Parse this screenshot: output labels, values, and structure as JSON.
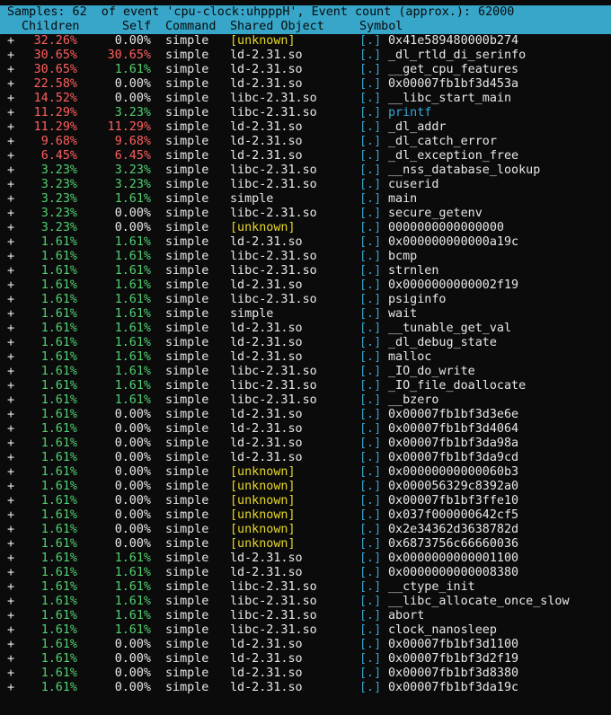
{
  "title": "Samples: 62  of event 'cpu-clock:uhpppH', Event count (approx.): 62000",
  "headers": {
    "children": "Children",
    "self": "Self",
    "command": "Command",
    "shared_object": "Shared Object",
    "symbol": "Symbol"
  },
  "colors": {
    "header_bg": "#37a6c9",
    "red": "#ff5f5f",
    "green": "#52d071",
    "yellow": "#e7d82a",
    "cyan": "#36a7d6"
  },
  "rows": [
    {
      "plus": "+",
      "children": "32.26%",
      "self": "0.00%",
      "command": "simple",
      "shared": "[unknown]",
      "mark": "[.]",
      "symbol": "0x41e589480000b274",
      "cc": "red",
      "sc": "white",
      "shc": "yellow",
      "syc": "white"
    },
    {
      "plus": "+",
      "children": "30.65%",
      "self": "30.65%",
      "command": "simple",
      "shared": "ld-2.31.so",
      "mark": "[.]",
      "symbol": "_dl_rtld_di_serinfo",
      "cc": "red",
      "sc": "red",
      "shc": "white",
      "syc": "white"
    },
    {
      "plus": "+",
      "children": "30.65%",
      "self": "1.61%",
      "command": "simple",
      "shared": "ld-2.31.so",
      "mark": "[.]",
      "symbol": "__get_cpu_features",
      "cc": "red",
      "sc": "green",
      "shc": "white",
      "syc": "white"
    },
    {
      "plus": "+",
      "children": "22.58%",
      "self": "0.00%",
      "command": "simple",
      "shared": "ld-2.31.so",
      "mark": "[.]",
      "symbol": "0x00007fb1bf3d453a",
      "cc": "red",
      "sc": "white",
      "shc": "white",
      "syc": "white"
    },
    {
      "plus": "+",
      "children": "14.52%",
      "self": "0.00%",
      "command": "simple",
      "shared": "libc-2.31.so",
      "mark": "[.]",
      "symbol": "__libc_start_main",
      "cc": "red",
      "sc": "white",
      "shc": "white",
      "syc": "white"
    },
    {
      "plus": "+",
      "children": "11.29%",
      "self": "3.23%",
      "command": "simple",
      "shared": "libc-2.31.so",
      "mark": "[.]",
      "symbol": "printf",
      "cc": "red",
      "sc": "green",
      "shc": "white",
      "syc": "cyan"
    },
    {
      "plus": "+",
      "children": "11.29%",
      "self": "11.29%",
      "command": "simple",
      "shared": "ld-2.31.so",
      "mark": "[.]",
      "symbol": "_dl_addr",
      "cc": "red",
      "sc": "red",
      "shc": "white",
      "syc": "white"
    },
    {
      "plus": "+",
      "children": "9.68%",
      "self": "9.68%",
      "command": "simple",
      "shared": "ld-2.31.so",
      "mark": "[.]",
      "symbol": "_dl_catch_error",
      "cc": "red",
      "sc": "red",
      "shc": "white",
      "syc": "white"
    },
    {
      "plus": "+",
      "children": "6.45%",
      "self": "6.45%",
      "command": "simple",
      "shared": "ld-2.31.so",
      "mark": "[.]",
      "symbol": "_dl_exception_free",
      "cc": "red",
      "sc": "red",
      "shc": "white",
      "syc": "white"
    },
    {
      "plus": "+",
      "children": "3.23%",
      "self": "3.23%",
      "command": "simple",
      "shared": "libc-2.31.so",
      "mark": "[.]",
      "symbol": "__nss_database_lookup",
      "cc": "green",
      "sc": "green",
      "shc": "white",
      "syc": "white"
    },
    {
      "plus": "+",
      "children": "3.23%",
      "self": "3.23%",
      "command": "simple",
      "shared": "libc-2.31.so",
      "mark": "[.]",
      "symbol": "cuserid",
      "cc": "green",
      "sc": "green",
      "shc": "white",
      "syc": "white"
    },
    {
      "plus": "+",
      "children": "3.23%",
      "self": "1.61%",
      "command": "simple",
      "shared": "simple",
      "mark": "[.]",
      "symbol": "main",
      "cc": "green",
      "sc": "green",
      "shc": "white",
      "syc": "white"
    },
    {
      "plus": "+",
      "children": "3.23%",
      "self": "0.00%",
      "command": "simple",
      "shared": "libc-2.31.so",
      "mark": "[.]",
      "symbol": "secure_getenv",
      "cc": "green",
      "sc": "white",
      "shc": "white",
      "syc": "white"
    },
    {
      "plus": "+",
      "children": "3.23%",
      "self": "0.00%",
      "command": "simple",
      "shared": "[unknown]",
      "mark": "[.]",
      "symbol": "0000000000000000",
      "cc": "green",
      "sc": "white",
      "shc": "yellow",
      "syc": "white"
    },
    {
      "plus": "+",
      "children": "1.61%",
      "self": "1.61%",
      "command": "simple",
      "shared": "ld-2.31.so",
      "mark": "[.]",
      "symbol": "0x000000000000a19c",
      "cc": "green",
      "sc": "green",
      "shc": "white",
      "syc": "white"
    },
    {
      "plus": "+",
      "children": "1.61%",
      "self": "1.61%",
      "command": "simple",
      "shared": "libc-2.31.so",
      "mark": "[.]",
      "symbol": "bcmp",
      "cc": "green",
      "sc": "green",
      "shc": "white",
      "syc": "white"
    },
    {
      "plus": "+",
      "children": "1.61%",
      "self": "1.61%",
      "command": "simple",
      "shared": "libc-2.31.so",
      "mark": "[.]",
      "symbol": "strnlen",
      "cc": "green",
      "sc": "green",
      "shc": "white",
      "syc": "white"
    },
    {
      "plus": "+",
      "children": "1.61%",
      "self": "1.61%",
      "command": "simple",
      "shared": "ld-2.31.so",
      "mark": "[.]",
      "symbol": "0x0000000000002f19",
      "cc": "green",
      "sc": "green",
      "shc": "white",
      "syc": "white"
    },
    {
      "plus": "+",
      "children": "1.61%",
      "self": "1.61%",
      "command": "simple",
      "shared": "libc-2.31.so",
      "mark": "[.]",
      "symbol": "psiginfo",
      "cc": "green",
      "sc": "green",
      "shc": "white",
      "syc": "white"
    },
    {
      "plus": "+",
      "children": "1.61%",
      "self": "1.61%",
      "command": "simple",
      "shared": "simple",
      "mark": "[.]",
      "symbol": "wait",
      "cc": "green",
      "sc": "green",
      "shc": "white",
      "syc": "white"
    },
    {
      "plus": "+",
      "children": "1.61%",
      "self": "1.61%",
      "command": "simple",
      "shared": "ld-2.31.so",
      "mark": "[.]",
      "symbol": "__tunable_get_val",
      "cc": "green",
      "sc": "green",
      "shc": "white",
      "syc": "white"
    },
    {
      "plus": "+",
      "children": "1.61%",
      "self": "1.61%",
      "command": "simple",
      "shared": "ld-2.31.so",
      "mark": "[.]",
      "symbol": "_dl_debug_state",
      "cc": "green",
      "sc": "green",
      "shc": "white",
      "syc": "white"
    },
    {
      "plus": "+",
      "children": "1.61%",
      "self": "1.61%",
      "command": "simple",
      "shared": "ld-2.31.so",
      "mark": "[.]",
      "symbol": "malloc",
      "cc": "green",
      "sc": "green",
      "shc": "white",
      "syc": "white"
    },
    {
      "plus": "+",
      "children": "1.61%",
      "self": "1.61%",
      "command": "simple",
      "shared": "libc-2.31.so",
      "mark": "[.]",
      "symbol": "_IO_do_write",
      "cc": "green",
      "sc": "green",
      "shc": "white",
      "syc": "white"
    },
    {
      "plus": "+",
      "children": "1.61%",
      "self": "1.61%",
      "command": "simple",
      "shared": "libc-2.31.so",
      "mark": "[.]",
      "symbol": "_IO_file_doallocate",
      "cc": "green",
      "sc": "green",
      "shc": "white",
      "syc": "white"
    },
    {
      "plus": "+",
      "children": "1.61%",
      "self": "1.61%",
      "command": "simple",
      "shared": "libc-2.31.so",
      "mark": "[.]",
      "symbol": "__bzero",
      "cc": "green",
      "sc": "green",
      "shc": "white",
      "syc": "white"
    },
    {
      "plus": "+",
      "children": "1.61%",
      "self": "0.00%",
      "command": "simple",
      "shared": "ld-2.31.so",
      "mark": "[.]",
      "symbol": "0x00007fb1bf3d3e6e",
      "cc": "green",
      "sc": "white",
      "shc": "white",
      "syc": "white"
    },
    {
      "plus": "+",
      "children": "1.61%",
      "self": "0.00%",
      "command": "simple",
      "shared": "ld-2.31.so",
      "mark": "[.]",
      "symbol": "0x00007fb1bf3d4064",
      "cc": "green",
      "sc": "white",
      "shc": "white",
      "syc": "white"
    },
    {
      "plus": "+",
      "children": "1.61%",
      "self": "0.00%",
      "command": "simple",
      "shared": "ld-2.31.so",
      "mark": "[.]",
      "symbol": "0x00007fb1bf3da98a",
      "cc": "green",
      "sc": "white",
      "shc": "white",
      "syc": "white"
    },
    {
      "plus": "+",
      "children": "1.61%",
      "self": "0.00%",
      "command": "simple",
      "shared": "ld-2.31.so",
      "mark": "[.]",
      "symbol": "0x00007fb1bf3da9cd",
      "cc": "green",
      "sc": "white",
      "shc": "white",
      "syc": "white"
    },
    {
      "plus": "+",
      "children": "1.61%",
      "self": "0.00%",
      "command": "simple",
      "shared": "[unknown]",
      "mark": "[.]",
      "symbol": "0x00000000000060b3",
      "cc": "green",
      "sc": "white",
      "shc": "yellow",
      "syc": "white"
    },
    {
      "plus": "+",
      "children": "1.61%",
      "self": "0.00%",
      "command": "simple",
      "shared": "[unknown]",
      "mark": "[.]",
      "symbol": "0x000056329c8392a0",
      "cc": "green",
      "sc": "white",
      "shc": "yellow",
      "syc": "white"
    },
    {
      "plus": "+",
      "children": "1.61%",
      "self": "0.00%",
      "command": "simple",
      "shared": "[unknown]",
      "mark": "[.]",
      "symbol": "0x00007fb1bf3ffe10",
      "cc": "green",
      "sc": "white",
      "shc": "yellow",
      "syc": "white"
    },
    {
      "plus": "+",
      "children": "1.61%",
      "self": "0.00%",
      "command": "simple",
      "shared": "[unknown]",
      "mark": "[.]",
      "symbol": "0x037f000000642cf5",
      "cc": "green",
      "sc": "white",
      "shc": "yellow",
      "syc": "white"
    },
    {
      "plus": "+",
      "children": "1.61%",
      "self": "0.00%",
      "command": "simple",
      "shared": "[unknown]",
      "mark": "[.]",
      "symbol": "0x2e34362d3638782d",
      "cc": "green",
      "sc": "white",
      "shc": "yellow",
      "syc": "white"
    },
    {
      "plus": "+",
      "children": "1.61%",
      "self": "0.00%",
      "command": "simple",
      "shared": "[unknown]",
      "mark": "[.]",
      "symbol": "0x6873756c66660036",
      "cc": "green",
      "sc": "white",
      "shc": "yellow",
      "syc": "white"
    },
    {
      "plus": "+",
      "children": "1.61%",
      "self": "1.61%",
      "command": "simple",
      "shared": "ld-2.31.so",
      "mark": "[.]",
      "symbol": "0x0000000000001100",
      "cc": "green",
      "sc": "green",
      "shc": "white",
      "syc": "white"
    },
    {
      "plus": "+",
      "children": "1.61%",
      "self": "1.61%",
      "command": "simple",
      "shared": "ld-2.31.so",
      "mark": "[.]",
      "symbol": "0x0000000000008380",
      "cc": "green",
      "sc": "green",
      "shc": "white",
      "syc": "white"
    },
    {
      "plus": "+",
      "children": "1.61%",
      "self": "1.61%",
      "command": "simple",
      "shared": "libc-2.31.so",
      "mark": "[.]",
      "symbol": "__ctype_init",
      "cc": "green",
      "sc": "green",
      "shc": "white",
      "syc": "white"
    },
    {
      "plus": "+",
      "children": "1.61%",
      "self": "1.61%",
      "command": "simple",
      "shared": "libc-2.31.so",
      "mark": "[.]",
      "symbol": "__libc_allocate_once_slow",
      "cc": "green",
      "sc": "green",
      "shc": "white",
      "syc": "white"
    },
    {
      "plus": "+",
      "children": "1.61%",
      "self": "1.61%",
      "command": "simple",
      "shared": "libc-2.31.so",
      "mark": "[.]",
      "symbol": "abort",
      "cc": "green",
      "sc": "green",
      "shc": "white",
      "syc": "white"
    },
    {
      "plus": "+",
      "children": "1.61%",
      "self": "1.61%",
      "command": "simple",
      "shared": "libc-2.31.so",
      "mark": "[.]",
      "symbol": "clock_nanosleep",
      "cc": "green",
      "sc": "green",
      "shc": "white",
      "syc": "white"
    },
    {
      "plus": "+",
      "children": "1.61%",
      "self": "0.00%",
      "command": "simple",
      "shared": "ld-2.31.so",
      "mark": "[.]",
      "symbol": "0x00007fb1bf3d1100",
      "cc": "green",
      "sc": "white",
      "shc": "white",
      "syc": "white"
    },
    {
      "plus": "+",
      "children": "1.61%",
      "self": "0.00%",
      "command": "simple",
      "shared": "ld-2.31.so",
      "mark": "[.]",
      "symbol": "0x00007fb1bf3d2f19",
      "cc": "green",
      "sc": "white",
      "shc": "white",
      "syc": "white"
    },
    {
      "plus": "+",
      "children": "1.61%",
      "self": "0.00%",
      "command": "simple",
      "shared": "ld-2.31.so",
      "mark": "[.]",
      "symbol": "0x00007fb1bf3d8380",
      "cc": "green",
      "sc": "white",
      "shc": "white",
      "syc": "white"
    },
    {
      "plus": "+",
      "children": "1.61%",
      "self": "0.00%",
      "command": "simple",
      "shared": "ld-2.31.so",
      "mark": "[.]",
      "symbol": "0x00007fb1bf3da19c",
      "cc": "green",
      "sc": "white",
      "shc": "white",
      "syc": "white"
    }
  ]
}
